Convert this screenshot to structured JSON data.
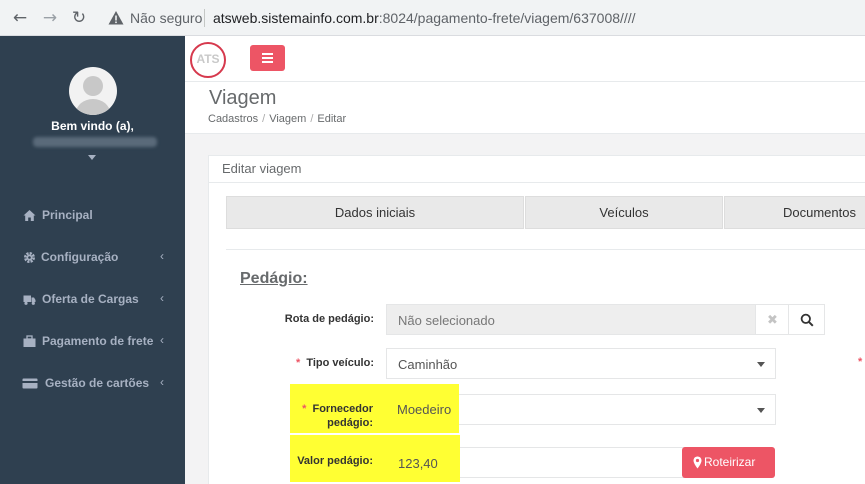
{
  "browser": {
    "insecure_label": "Não seguro",
    "url_host": "atsweb.sistemainfo.com.br",
    "url_path": ":8024/pagamento-frete/viagem/637008////"
  },
  "sidebar": {
    "welcome": "Bem vindo (a),",
    "items": [
      {
        "label": "Principal",
        "icon": "home-icon"
      },
      {
        "label": "Configuração",
        "icon": "gear-icon"
      },
      {
        "label": "Oferta de Cargas",
        "icon": "truck-icon"
      },
      {
        "label": "Pagamento de frete",
        "icon": "briefcase-icon"
      },
      {
        "label": "Gestão de cartões",
        "icon": "credit-card-icon"
      }
    ]
  },
  "header": {
    "logo_text": "ATS"
  },
  "page": {
    "title": "Viagem",
    "breadcrumb": [
      "Cadastros",
      "Viagem",
      "Editar"
    ]
  },
  "panel": {
    "title": "Editar viagem",
    "tabs": [
      "Dados iniciais",
      "Veículos",
      "Documentos"
    ]
  },
  "form": {
    "section_title": "Pedágio:",
    "rota_label": "Rota de pedágio:",
    "rota_value": "Não selecionado",
    "tipo_label": "Tipo veículo:",
    "tipo_value": "Caminhão",
    "fornecedor_label_1": "Fornecedor",
    "fornecedor_label_2": "pedágio:",
    "fornecedor_value": "Moedeiro",
    "valor_label": "Valor pedágio:",
    "valor_value": "123,40",
    "required_mark": "*",
    "roteirizar_label": "Roteirizar"
  },
  "colors": {
    "sidebar_bg": "#2f4050",
    "accent_red": "#ed5565",
    "highlight": "#ffff33"
  }
}
